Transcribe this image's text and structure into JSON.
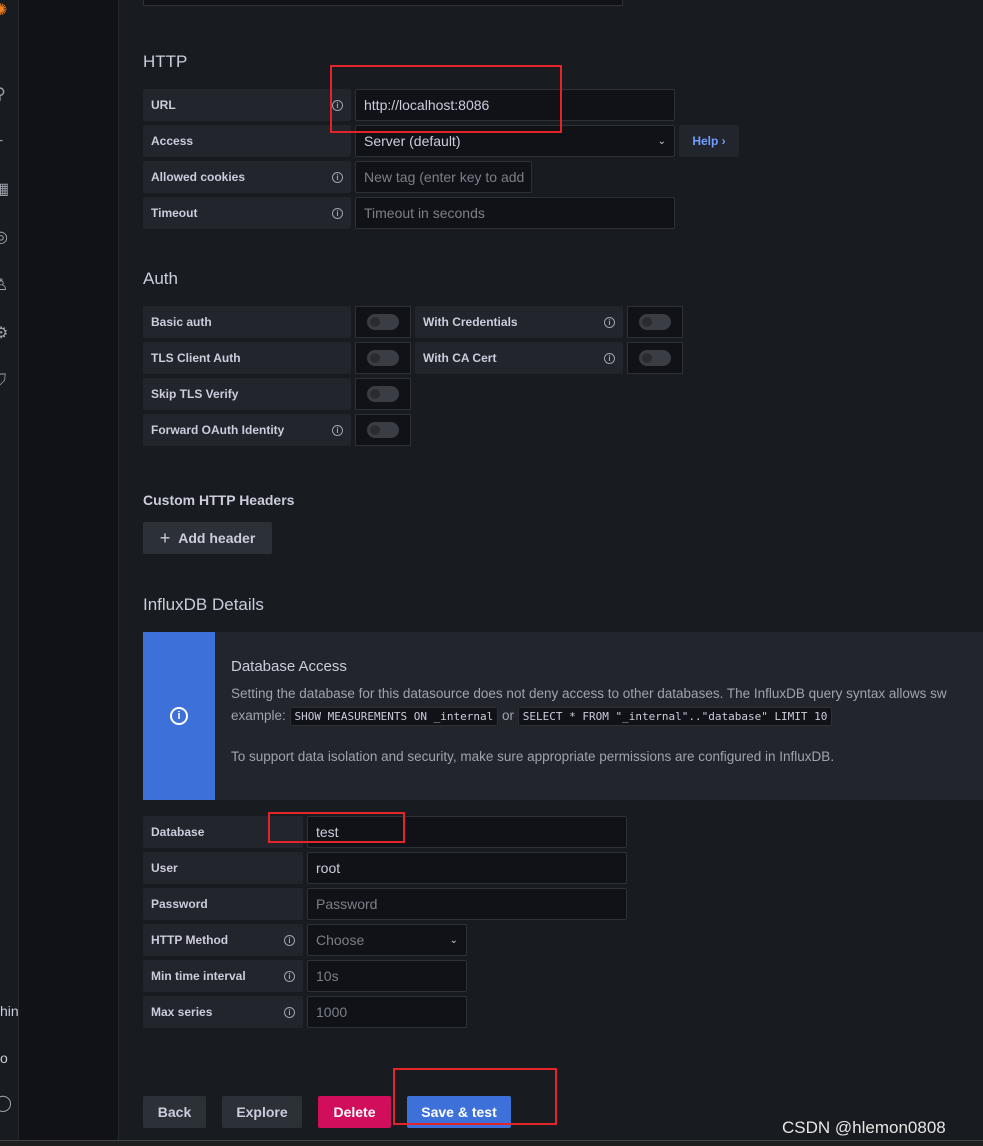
{
  "sidebar": {
    "icons": [
      "grafana-logo-icon",
      "search-icon",
      "plus-icon",
      "dashboards-icon",
      "explore-icon",
      "alerting-icon",
      "gear-icon",
      "shield-icon",
      "help-icon"
    ],
    "fragments": [
      "hin",
      "o"
    ]
  },
  "http": {
    "title": "HTTP",
    "url_label": "URL",
    "url_value": "http://localhost:8086",
    "access_label": "Access",
    "access_value": "Server (default)",
    "help_label": "Help",
    "cookies_label": "Allowed cookies",
    "cookies_placeholder": "New tag (enter key to add",
    "timeout_label": "Timeout",
    "timeout_placeholder": "Timeout in seconds"
  },
  "auth": {
    "title": "Auth",
    "basic": "Basic auth",
    "with_credentials": "With Credentials",
    "tls_client": "TLS Client Auth",
    "with_ca": "With CA Cert",
    "skip_tls": "Skip TLS Verify",
    "forward_oauth": "Forward OAuth Identity",
    "toggles": {
      "basic": false,
      "with_credentials": false,
      "tls_client": false,
      "with_ca": false,
      "skip_tls": false,
      "forward_oauth": false
    }
  },
  "headers": {
    "title": "Custom HTTP Headers",
    "add": "Add header"
  },
  "influx": {
    "title": "InfluxDB Details",
    "alert_title": "Database Access",
    "alert_p1": "Setting the database for this datasource does not deny access to other databases. The InfluxDB query syntax allows sw",
    "alert_example": "example:",
    "code1": "SHOW MEASUREMENTS ON _internal",
    "or": "or",
    "code2": "SELECT * FROM \"_internal\"..\"database\" LIMIT 10",
    "alert_p2": "To support data isolation and security, make sure appropriate permissions are configured in InfluxDB.",
    "database_label": "Database",
    "database_value": "test",
    "user_label": "User",
    "user_value": "root",
    "password_label": "Password",
    "password_placeholder": "Password",
    "method_label": "HTTP Method",
    "method_value": "Choose",
    "min_label": "Min time interval",
    "min_placeholder": "10s",
    "max_label": "Max series",
    "max_placeholder": "1000"
  },
  "actions": {
    "back": "Back",
    "explore": "Explore",
    "delete": "Delete",
    "save": "Save & test"
  },
  "colors": {
    "primary": "#3d71d9",
    "destructive": "#d10e5c",
    "annotation": "#e5242a"
  },
  "watermark": "CSDN @hlemon0808"
}
